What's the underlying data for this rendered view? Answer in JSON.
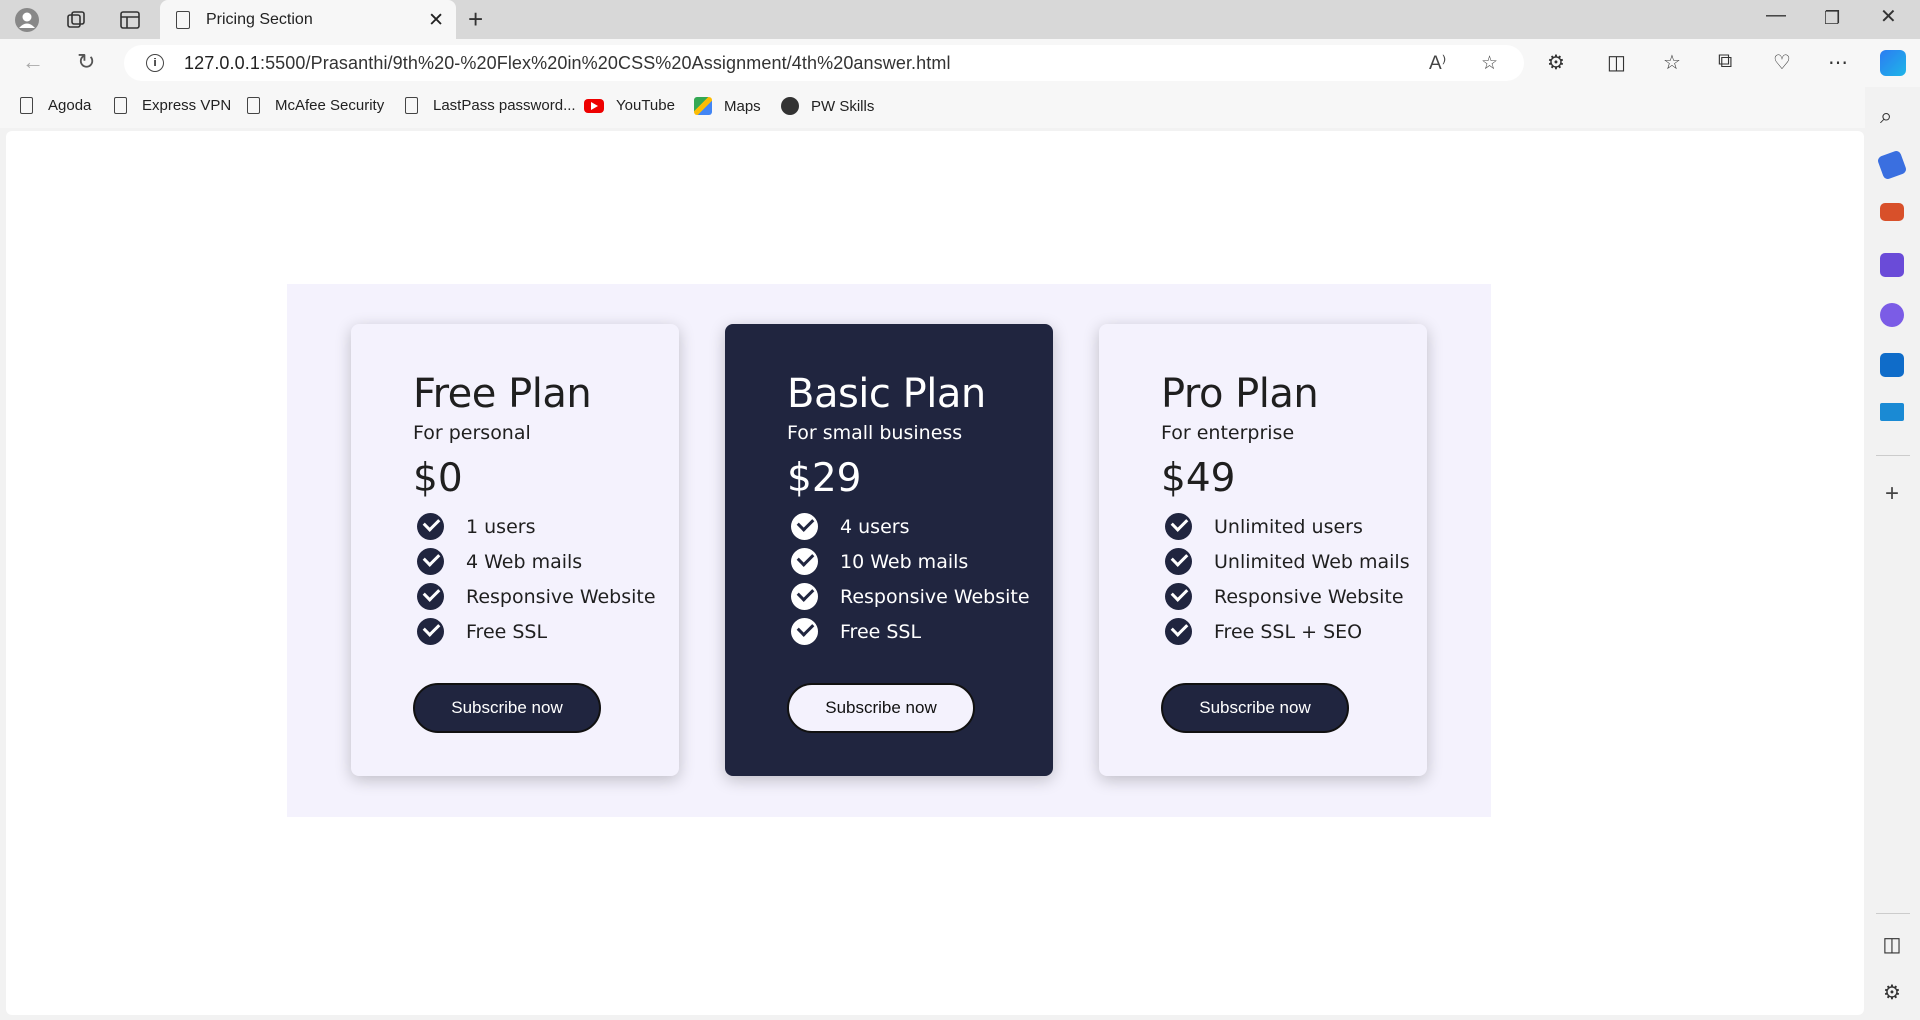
{
  "browser": {
    "tab_title": "Pricing Section",
    "url_host": "127.0.0.1",
    "url_path": ":5500/Prasanthi/9th%20-%20Flex%20in%20CSS%20Assignment/4th%20answer.html",
    "new_tab_label": "+",
    "bookmarks": [
      "Agoda",
      "Express VPN",
      "McAfee Security",
      "LastPass password...",
      "YouTube",
      "Maps",
      "PW Skills"
    ]
  },
  "plans": [
    {
      "name": "Free Plan",
      "subtitle": "For personal",
      "price": "$0",
      "features": [
        "1 users",
        "4 Web mails",
        "Responsive Website",
        "Free SSL"
      ],
      "button": "Subscribe now"
    },
    {
      "name": "Basic Plan",
      "subtitle": "For small business",
      "price": "$29",
      "features": [
        "4 users",
        "10 Web mails",
        "Responsive Website",
        "Free SSL"
      ],
      "button": "Subscribe now"
    },
    {
      "name": "Pro Plan",
      "subtitle": "For enterprise",
      "price": "$49",
      "features": [
        "Unlimited users",
        "Unlimited Web mails",
        "Responsive Website",
        "Free SSL + SEO"
      ],
      "button": "Subscribe now"
    }
  ],
  "colors": {
    "dark_card": "#20253f",
    "section_bg": "#f4f2fd"
  }
}
